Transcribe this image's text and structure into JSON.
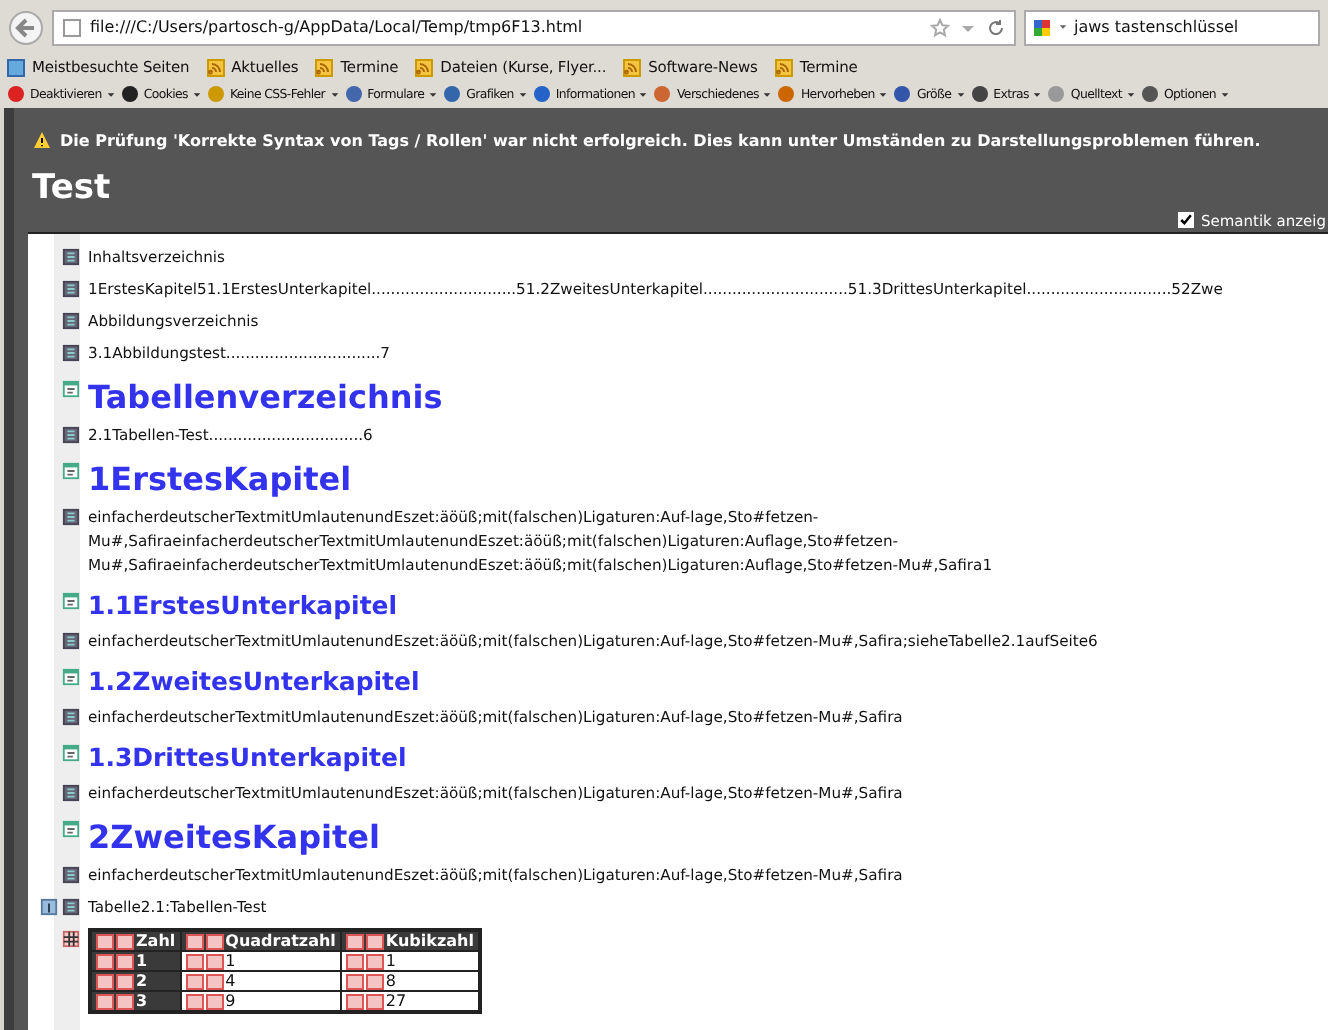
{
  "browser": {
    "url": "file:///C:/Users/partosch-g/AppData/Local/Temp/tmp6F13.html",
    "search": "jaws tastenschlüssel",
    "bookmarks": [
      "Meistbesuchte Seiten",
      "Aktuelles",
      "Termine",
      "Dateien (Kurse, Flyer...",
      "Software-News",
      "Termine"
    ],
    "toolbar": [
      "Deaktivieren",
      "Cookies",
      "Keine CSS-Fehler",
      "Formulare",
      "Grafiken",
      "Informationen",
      "Verschiedenes",
      "Hervorheben",
      "Größe",
      "Extras",
      "Quelltext",
      "Optionen"
    ]
  },
  "warning": "Die Prüfung 'Korrekte Syntax von Tags / Rollen' war nicht erfolgreich. Dies kann unter Umständen zu Darstellungsproblemen führen.",
  "page_title": "Test",
  "semantics_toggle": {
    "label": "Semantik anzeig",
    "checked": true
  },
  "blocks": [
    {
      "kind": "para",
      "text": "Inhaltsverzeichnis"
    },
    {
      "kind": "toc",
      "text": "1ErstesKapitel51.1ErstesUnterkapitel..............................51.2ZweitesUnterkapitel..............................51.3DrittesUnterkapitel..............................52Zwe"
    },
    {
      "kind": "para",
      "text": "Abbildungsverzeichnis"
    },
    {
      "kind": "para",
      "text": "3.1Abbildungstest................................7"
    },
    {
      "kind": "h1",
      "text": "Tabellenverzeichnis"
    },
    {
      "kind": "para",
      "text": "2.1Tabellen-Test................................6"
    },
    {
      "kind": "h1",
      "text": "1ErstesKapitel"
    },
    {
      "kind": "para",
      "text": "einfacherdeutscherTextmitUmlautenundEszet:äöüß;mit(falschen)Ligaturen:Auf-lage,Sto#fetzen-Mu#,SafiraeinfacherdeutscherTextmitUmlautenundEszet:äöüß;mit(falschen)Ligaturen:Auflage,Sto#fetzen-Mu#,SafiraeinfacherdeutscherTextmitUmlautenundEszet:äöüß;mit(falschen)Ligaturen:Auflage,Sto#fetzen-Mu#,Safira1"
    },
    {
      "kind": "h2",
      "text": "1.1ErstesUnterkapitel"
    },
    {
      "kind": "para",
      "text": "einfacherdeutscherTextmitUmlautenundEszet:äöüß;mit(falschen)Ligaturen:Auf-lage,Sto#fetzen-Mu#,Safira;sieheTabelle2.1aufSeite6"
    },
    {
      "kind": "h2",
      "text": "1.2ZweitesUnterkapitel"
    },
    {
      "kind": "para",
      "text": "einfacherdeutscherTextmitUmlautenundEszet:äöüß;mit(falschen)Ligaturen:Auf-lage,Sto#fetzen-Mu#,Safira"
    },
    {
      "kind": "h2",
      "text": "1.3DrittesUnterkapitel"
    },
    {
      "kind": "para",
      "text": "einfacherdeutscherTextmitUmlautenundEszet:äöüß;mit(falschen)Ligaturen:Auf-lage,Sto#fetzen-Mu#,Safira"
    },
    {
      "kind": "h1",
      "text": "2ZweitesKapitel"
    },
    {
      "kind": "para",
      "text": "einfacherdeutscherTextmitUmlautenundEszet:äöüß;mit(falschen)Ligaturen:Auf-lage,Sto#fetzen-Mu#,Safira"
    },
    {
      "kind": "caption",
      "text": "Tabelle2.1:Tabellen-Test"
    }
  ],
  "table": {
    "columns": [
      "Zahl",
      "Quadratzahl",
      "Kubikzahl"
    ],
    "rows": [
      [
        "1",
        "1",
        "1"
      ],
      [
        "2",
        "4",
        "8"
      ],
      [
        "3",
        "9",
        "27"
      ]
    ]
  }
}
